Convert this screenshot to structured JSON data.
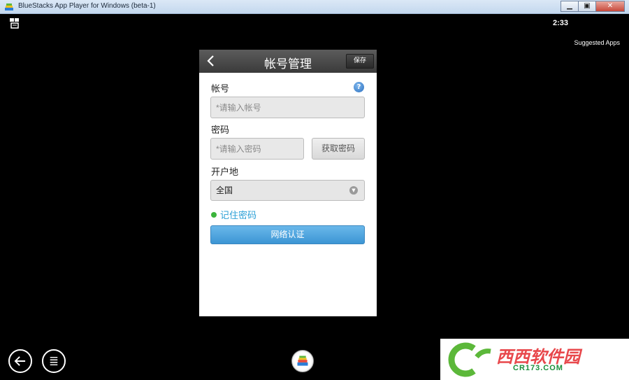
{
  "window": {
    "title": "BlueStacks App Player for Windows (beta-1)",
    "min_label": "▁",
    "max_label": "▣",
    "close_label": "✕"
  },
  "statusbar": {
    "time": "2:33",
    "suggested_apps": "Suggested Apps"
  },
  "app": {
    "header_title": "帐号管理",
    "save_label": "保存",
    "account_label": "帐号",
    "help_glyph": "?",
    "account_placeholder": "*请输入帐号",
    "password_label": "密码",
    "password_placeholder": "*请输入密码",
    "fetch_password_label": "获取密码",
    "region_label": "开户地",
    "region_value": "全国",
    "remember_label": "记住密码",
    "auth_button_label": "网络认证"
  },
  "watermark": {
    "brand": "西西软件园",
    "domain": "CR173.COM"
  },
  "colors": {
    "accent_blue": "#3c95d4",
    "link_blue": "#2a9fd6",
    "remember_green": "#3cb43c",
    "header_gray": "#4a4a4a"
  }
}
